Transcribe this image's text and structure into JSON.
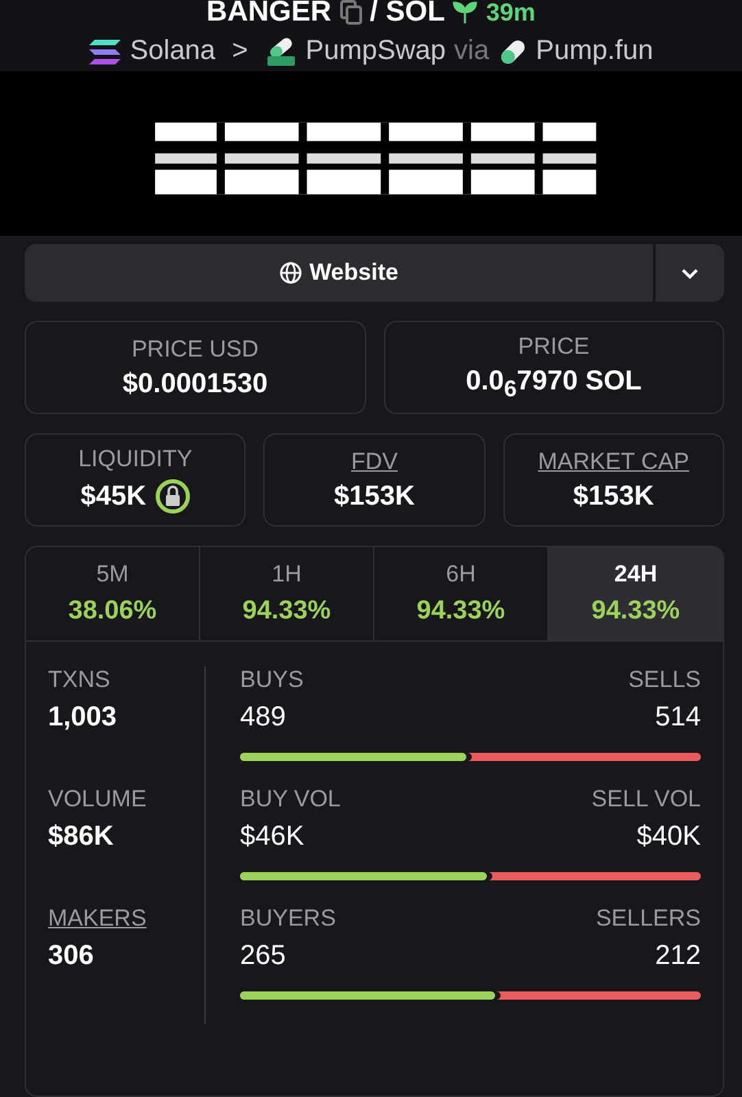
{
  "header": {
    "token": "BANGER",
    "quote": "/ SOL",
    "age": "39m",
    "chain": "Solana",
    "separator": ">",
    "dex": "PumpSwap",
    "via": "via",
    "launchpad": "Pump.fun"
  },
  "website_button": {
    "label": "Website"
  },
  "prices": [
    {
      "label": "PRICE USD",
      "value": "$0.0001530"
    },
    {
      "label": "PRICE",
      "value": "0.0$_{6}$7970 SOL"
    }
  ],
  "metrics": [
    {
      "label": "LIQUIDITY",
      "value": "$45K",
      "underlined": false,
      "locked": true
    },
    {
      "label": "FDV",
      "value": "$153K",
      "underlined": true,
      "locked": false
    },
    {
      "label": "MARKET CAP",
      "value": "$153K",
      "underlined": true,
      "locked": false
    }
  ],
  "timeframes": [
    {
      "label": "5M",
      "change": "38.06%",
      "selected": false
    },
    {
      "label": "1H",
      "change": "94.33%",
      "selected": false
    },
    {
      "label": "6H",
      "change": "94.33%",
      "selected": false
    },
    {
      "label": "24H",
      "change": "94.33%",
      "selected": true
    }
  ],
  "stats": [
    {
      "label": "TXNS",
      "value": "1,003",
      "underlined": false,
      "left_label": "BUYS",
      "left_value": "489",
      "right_label": "SELLS",
      "right_value": "514",
      "level": 0.49
    },
    {
      "label": "VOLUME",
      "value": "$86K",
      "underlined": false,
      "left_label": "BUY VOL",
      "left_value": "$46K",
      "right_label": "SELL VOL",
      "right_value": "$40K",
      "level": 0.535
    },
    {
      "label": "MAKERS",
      "value": "306",
      "underlined": true,
      "left_label": "BUYERS",
      "left_value": "265",
      "right_label": "SELLERS",
      "right_value": "212",
      "level": 0.555
    }
  ]
}
